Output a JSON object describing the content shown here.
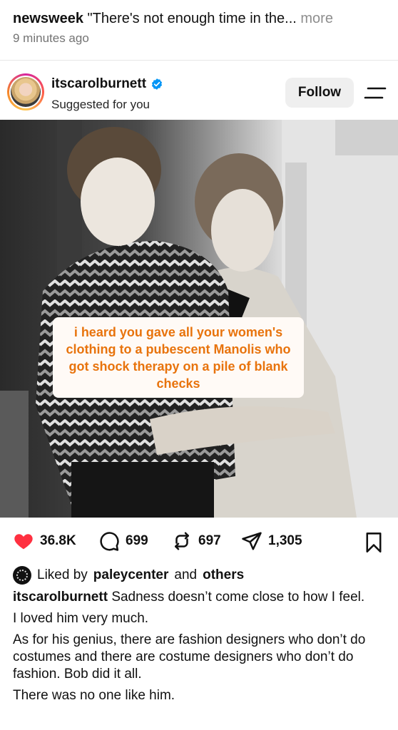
{
  "previous_post": {
    "username": "newsweek",
    "caption": "\"There's not enough time in the...",
    "more_label": "more",
    "timestamp": "9 minutes ago"
  },
  "post": {
    "username": "itscarolburnett",
    "subtitle": "Suggested for you",
    "follow_label": "Follow",
    "photo_caption": "i heard you gave all your women's clothing to a pubescent Manolis who got shock therapy on a pile of blank checks",
    "likes_count": "36.8K",
    "comments_count": "699",
    "reposts_count": "697",
    "shares_count": "1,305",
    "liked_by": {
      "prefix": "Liked by",
      "user": "paleycenter",
      "conjunction": "and",
      "others": "others"
    },
    "caption_author": "itscarolburnett",
    "caption_lines": [
      "Sadness doesn’t come close to how I feel.",
      "I loved him very much.",
      "As for his genius, there are fashion designers who don’t do costumes and there are costume designers who don’t do fashion. Bob did it all.",
      "There was no one like him."
    ]
  },
  "colors": {
    "like_red": "#ff3040",
    "verified_blue": "#0095f6",
    "caption_orange": "#e8730c",
    "follow_bg": "#efefef"
  },
  "icons": [
    "verified-badge-icon",
    "menu-icon",
    "heart-icon",
    "comment-icon",
    "repost-icon",
    "share-icon",
    "bookmark-icon"
  ]
}
